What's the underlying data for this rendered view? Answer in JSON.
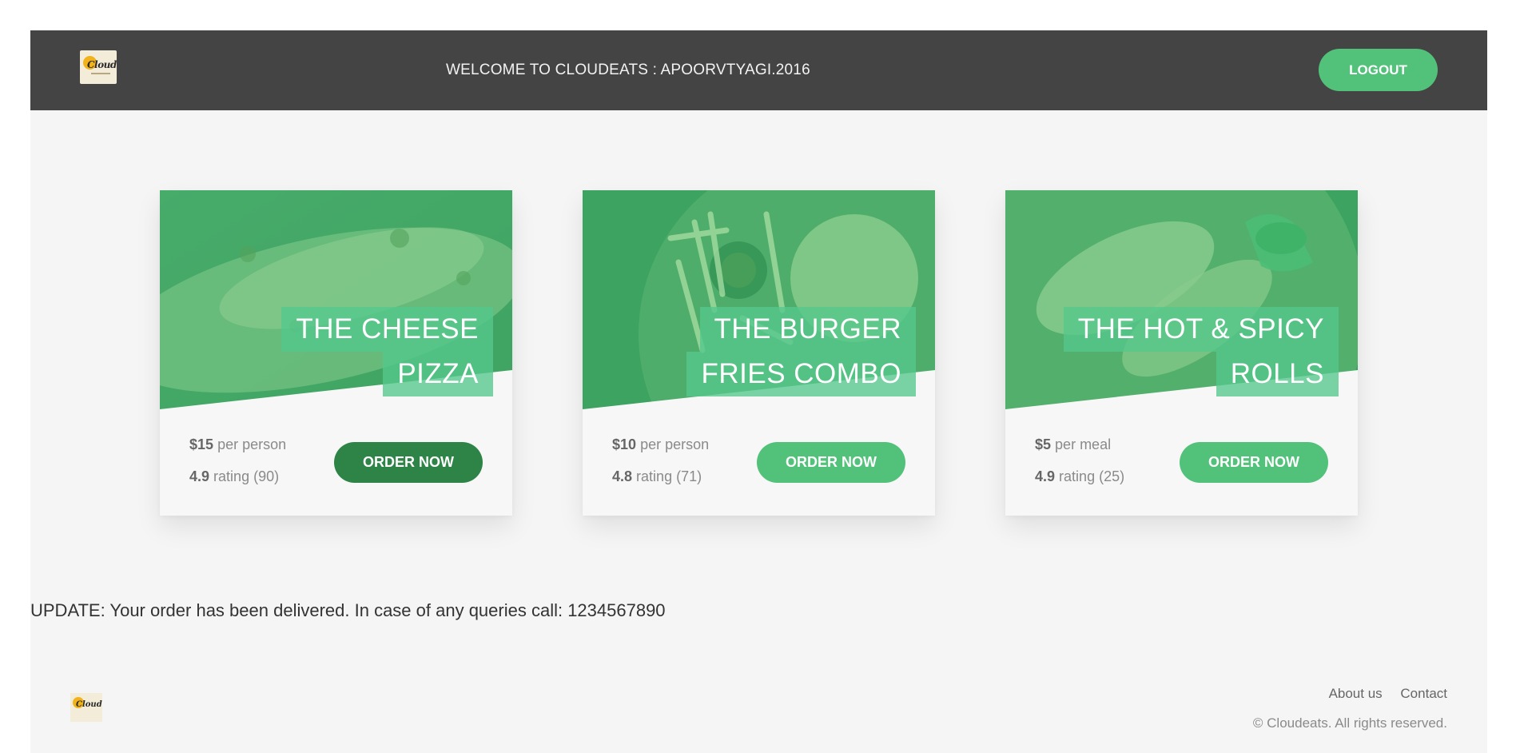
{
  "header": {
    "welcome_text": "WELCOME TO CLOUDEATS : APOORVTYAGI.2016",
    "logout_label": "LOGOUT",
    "logo_text": "Cloud"
  },
  "colors": {
    "header_bg": "#444444",
    "accent_green": "#52c27a",
    "dark_green": "#2e8446",
    "page_bg": "#f5f5f5"
  },
  "cards": [
    {
      "title_line1": "THE CHEESE",
      "title_line2": "PIZZA",
      "price": "$15",
      "price_unit": "per person",
      "rating": "4.9",
      "rating_text": "rating (90)",
      "button_label": "ORDER NOW",
      "button_color": "#2e8446",
      "image_icon": "pizza-photo"
    },
    {
      "title_line1": "THE BURGER",
      "title_line2": "FRIES COMBO",
      "price": "$10",
      "price_unit": "per person",
      "rating": "4.8",
      "rating_text": "rating (71)",
      "button_label": "ORDER NOW",
      "button_color": "#52c27a",
      "image_icon": "burger-fries-photo"
    },
    {
      "title_line1": "THE HOT & SPICY",
      "title_line2": "ROLLS",
      "price": "$5",
      "price_unit": "per meal",
      "rating": "4.9",
      "rating_text": "rating (25)",
      "button_label": "ORDER NOW",
      "button_color": "#52c27a",
      "image_icon": "rolls-photo"
    }
  ],
  "update_text": "UPDATE: Your order has been delivered. In case of any queries call: 1234567890",
  "footer": {
    "about_label": "About us",
    "contact_label": "Contact",
    "copyright": "© Cloudeats. All rights reserved.",
    "logo_text": "Cloud"
  }
}
